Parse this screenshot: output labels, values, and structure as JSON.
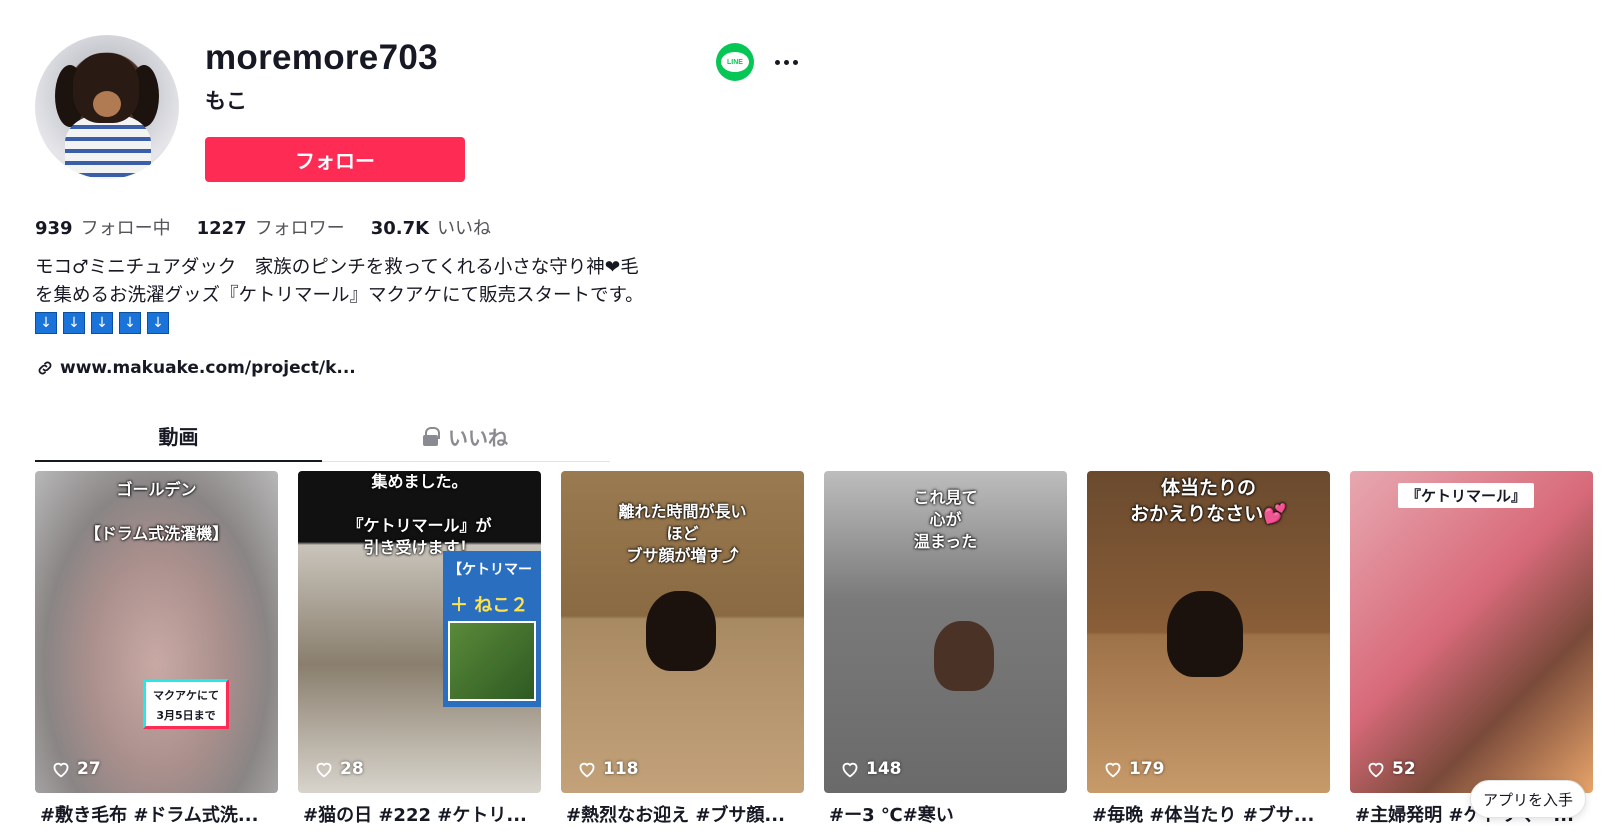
{
  "profile": {
    "username": "moremore703",
    "nickname": "もこ",
    "follow_label": "フォロー",
    "line_label": "LINE"
  },
  "stats": [
    {
      "value": "939",
      "label": "フォロー中"
    },
    {
      "value": "1227",
      "label": "フォロワー"
    },
    {
      "value": "30.7K",
      "label": "いいね"
    }
  ],
  "bio": {
    "line1": "モコ♂ミニチュアダック　家族のピンチを救ってくれる小さな守り神❤毛",
    "line2": "を集めるお洗濯グッズ『ケトリマール』マクアケにて販売スタートです。",
    "arrows": [
      "↓",
      "↓",
      "↓",
      "↓",
      "↓"
    ]
  },
  "link": {
    "text": "www.makuake.com/project/k..."
  },
  "tabs": [
    {
      "label": "動画"
    },
    {
      "label": "いいね"
    }
  ],
  "videos": [
    {
      "caption": "ゴールデン\n\n【ドラム式洗濯機】",
      "badge": "マクアケにて\n3月5日まで",
      "likes": "27",
      "desc": "#敷き毛布 #ドラム式洗..."
    },
    {
      "caption": "集めました。\n\n『ケトリマール』が\n引き受けます！",
      "panel_text": "【ケトリマー",
      "panel_text2": "＋ ねこ２",
      "likes": "28",
      "desc": "#猫の日 #222 #ケトリ..."
    },
    {
      "caption": "離れた時間が長い\nほど\nブサ顔が増す⤴",
      "likes": "118",
      "desc": "#熱烈なお迎え #ブサ顔..."
    },
    {
      "caption": "これ見て\n心が\n温まった",
      "likes": "148",
      "desc": "#ー3 ℃#寒い"
    },
    {
      "caption": "体当たりの\nおかえりなさい💕",
      "likes": "179",
      "desc": "#毎晩 #体当たり #ブサ..."
    },
    {
      "caption": "",
      "tag": "『ケトリマール』",
      "likes": "52",
      "desc": "#主婦発明 #ケトリマー..."
    }
  ],
  "get_app_label": "アプリを入手",
  "colors": {
    "accent": "#fe2c55",
    "line_green": "#06c755",
    "text": "#161823",
    "muted": "#8a8b91"
  }
}
